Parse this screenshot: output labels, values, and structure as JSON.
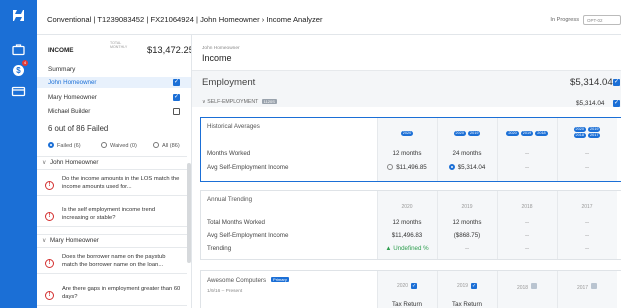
{
  "rail": {
    "badge_count": "4",
    "icons": [
      "app-logo-icon",
      "briefcase-icon",
      "dollar-icon",
      "card-icon"
    ]
  },
  "header": {
    "breadcrumb": "Conventional | T1239083452 | FX21064924 | John Homeowner  ›  Income Analyzer",
    "status": "In Progress",
    "option": "OPT-02"
  },
  "left": {
    "income_label": "INCOME",
    "total_label": "TOTAL MONTHLY",
    "total_value": "$13,472.25",
    "summary_label": "Summary",
    "borrowers": [
      {
        "name": "John Homeowner",
        "checked": true
      },
      {
        "name": "Mary Homeowner",
        "checked": true
      },
      {
        "name": "Michael Builder",
        "checked": false
      }
    ],
    "failed_summary": "6 out of 86 Failed",
    "filters": [
      "Failed (6)",
      "Waived (0)",
      "All (86)"
    ],
    "groups": [
      {
        "name": "John Homeowner",
        "questions": [
          "Do the income amounts in the LOS match the income amounts used for...",
          "Is the self employment income trend increasing or stable?"
        ]
      },
      {
        "name": "Mary Homeowner",
        "questions": [
          "Does the borrower name on the paystub match the borrower name on the loan...",
          "Are there gaps in employment greater than 60 days?"
        ]
      }
    ]
  },
  "main": {
    "borrower_sub": "John Homeowner",
    "title": "Income",
    "employment_label": "Employment",
    "employment_total": "$5,314.04",
    "self_employment_label": "SELF-EMPLOYMENT",
    "self_employment_tag": "1120S",
    "self_employment_total": "$5,314.04",
    "historical": {
      "title": "Historical Averages",
      "col_tags": [
        [
          "2020"
        ],
        [
          "2020",
          "2019"
        ],
        [
          "2020",
          "2019",
          "2018"
        ],
        [
          "2020",
          "2019",
          "2018",
          "2017"
        ]
      ],
      "rows": [
        {
          "label": "Months Worked",
          "values": [
            "12 months",
            "24 months",
            "--",
            "--"
          ]
        },
        {
          "label": "Avg Self-Employment Income",
          "values": [
            "$11,496.85",
            "$5,314.04",
            "--",
            "--"
          ]
        }
      ]
    },
    "annual": {
      "title": "Annual Trending",
      "years": [
        "2020",
        "2019",
        "2018",
        "2017"
      ],
      "rows": [
        {
          "label": "Total Months Worked",
          "values": [
            "12 months",
            "12 months",
            "--",
            "--"
          ]
        },
        {
          "label": "Avg Self-Employment Income",
          "values": [
            "$11,496.83",
            "($868.75)",
            "--",
            "--"
          ]
        },
        {
          "label": "Trending",
          "values": [
            "▲ Undefined %",
            "--",
            "--",
            "--"
          ]
        }
      ]
    },
    "company": {
      "name": "Awesome Computers",
      "badge": "Primary",
      "dates": "1/9/16 – Present",
      "years": [
        "2020",
        "2019",
        "2018",
        "2017"
      ],
      "years_checked": [
        true,
        true,
        false,
        false
      ],
      "doc_label": "Tax Return"
    }
  }
}
